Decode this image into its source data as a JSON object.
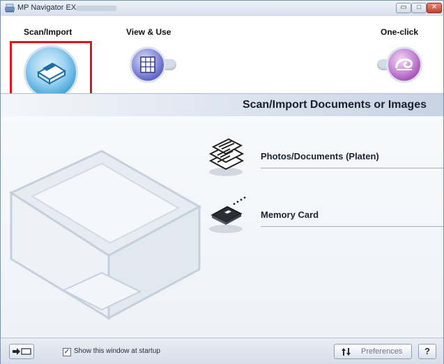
{
  "window": {
    "title": "MP Navigator EX",
    "minimize_glyph": "▭",
    "maximize_glyph": "□",
    "close_glyph": "✕"
  },
  "modes": {
    "scan_import": {
      "label": "Scan/Import",
      "icon": "scanner-icon",
      "selected": true
    },
    "view_use": {
      "label": "View & Use",
      "icon": "grid-icon",
      "selected": false
    },
    "one_click": {
      "label": "One-click",
      "icon": "swirl-icon",
      "selected": false
    }
  },
  "header": {
    "title": "Scan/Import Documents or Images"
  },
  "actions": [
    {
      "label": "Photos/Documents (Platen)",
      "icon": "documents-stack-icon"
    },
    {
      "label": "Memory Card",
      "icon": "memory-card-icon"
    }
  ],
  "footer": {
    "toggle_icon": "arrow-right-icon",
    "show_at_startup_label": "Show this window at startup",
    "show_at_startup_checked": true,
    "check_glyph": "✓",
    "preferences_label": "Preferences",
    "preferences_icon": "preferences-icon",
    "help_label": "?"
  },
  "colors": {
    "selection_frame": "#e0141b",
    "scan_button": "#3aa0d8",
    "view_button": "#4a50b8",
    "oneclick_button": "#9a3fb0"
  }
}
